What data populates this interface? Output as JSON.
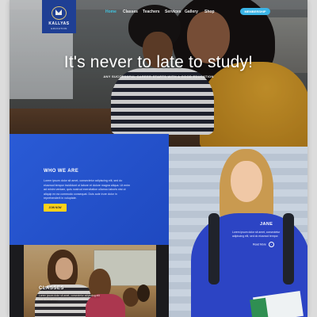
{
  "logo": {
    "name": "KALLYAS",
    "subtitle": "EDUCATION"
  },
  "nav": {
    "items": [
      {
        "label": "Home",
        "active": true
      },
      {
        "label": "Classes",
        "active": false
      },
      {
        "label": "Teachers",
        "active": false
      },
      {
        "label": "Services",
        "active": false
      },
      {
        "label": "Gallery",
        "active": false
      },
      {
        "label": "Shop",
        "active": false
      }
    ],
    "cta_label": "MEMBERSHIP"
  },
  "hero": {
    "headline": "It's never to late to study!",
    "tagline": "ANY SUCCESSFUL CAREER STARTS WITH A GOOD EDUCATION"
  },
  "who_we_are": {
    "title": "WHO WE ARE",
    "text": "Lorem ipsum dolor sit amet, consectetur adipiscing elit, sed do eiusmod tempor incididunt ut labore et dolore magna aliqua. Ut enim ad minim veniam, quis nostrud exercitation ullamco laboris nisi ut aliquip ex ea commodo consequat. Duis aute irure dolor in reprehenderit in voluptate.",
    "button_label": "JOIN NOW"
  },
  "jane": {
    "name": "JANE",
    "text": "Lorem ipsum dolor sit amet, consectetur adipiscing elit, sed do eiusmod tempor.",
    "link_label": "Read More"
  },
  "classes": {
    "title": "CLASSES",
    "text": "Lorem ipsum dolor sit amet, consectetur adipiscing elit sed do eiusmod."
  },
  "colors": {
    "brand_blue": "#1f3f94",
    "section_blue": "#2a5bd6",
    "accent_cyan": "#3bb4e6",
    "button_yellow": "#ffd21a"
  }
}
